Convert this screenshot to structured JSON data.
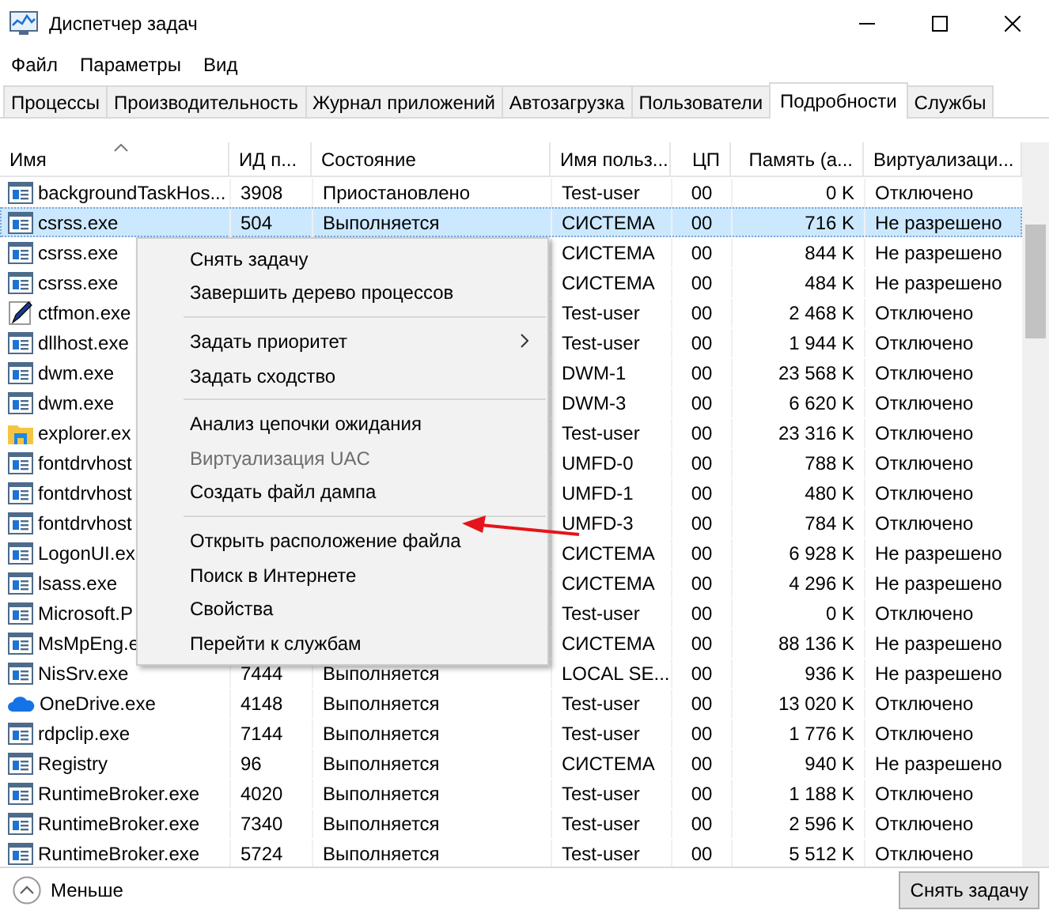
{
  "window": {
    "title": "Диспетчер задач"
  },
  "menu_bar": [
    "Файл",
    "Параметры",
    "Вид"
  ],
  "tabs": [
    {
      "label": "Процессы",
      "selected": false
    },
    {
      "label": "Производительность",
      "selected": false
    },
    {
      "label": "Журнал приложений",
      "selected": false
    },
    {
      "label": "Автозагрузка",
      "selected": false
    },
    {
      "label": "Пользователи",
      "selected": false
    },
    {
      "label": "Подробности",
      "selected": true
    },
    {
      "label": "Службы",
      "selected": false
    }
  ],
  "table": {
    "columns": [
      {
        "label": "Имя",
        "sorted": true
      },
      {
        "label": "ИД п...",
        "sorted": false
      },
      {
        "label": "Состояние",
        "sorted": false
      },
      {
        "label": "Имя польз...",
        "sorted": false
      },
      {
        "label": "ЦП",
        "sorted": false
      },
      {
        "label": "Память (а...",
        "sorted": false
      },
      {
        "label": "Виртуализаци...",
        "sorted": false
      }
    ],
    "rows": [
      {
        "kind": "app",
        "name": "backgroundTaskHos...",
        "pid": "3908",
        "state": "Приостановлено",
        "user": "Test-user",
        "cpu": "00",
        "memory": "0 K",
        "virtualization": "Отключено",
        "selected": false
      },
      {
        "kind": "app",
        "name": "csrss.exe",
        "pid": "504",
        "state": "Выполняется",
        "user": "СИСТЕМА",
        "cpu": "00",
        "memory": "716 K",
        "virtualization": "Не разрешено",
        "selected": true
      },
      {
        "kind": "app",
        "name": "csrss.exe",
        "user": "СИСТЕМА",
        "cpu": "00",
        "memory": "844 K",
        "virtualization": "Не разрешено",
        "selected": false
      },
      {
        "kind": "app",
        "name": "csrss.exe",
        "user": "СИСТЕМА",
        "cpu": "00",
        "memory": "484 K",
        "virtualization": "Не разрешено",
        "selected": false
      },
      {
        "kind": "pen",
        "name": "ctfmon.exe",
        "user": "Test-user",
        "cpu": "00",
        "memory": "2 468 K",
        "virtualization": "Отключено",
        "selected": false
      },
      {
        "kind": "app",
        "name": "dllhost.exe",
        "user": "Test-user",
        "cpu": "00",
        "memory": "1 944 K",
        "virtualization": "Отключено",
        "selected": false
      },
      {
        "kind": "app",
        "name": "dwm.exe",
        "user": "DWM-1",
        "cpu": "00",
        "memory": "23 568 K",
        "virtualization": "Отключено",
        "selected": false
      },
      {
        "kind": "app",
        "name": "dwm.exe",
        "user": "DWM-3",
        "cpu": "00",
        "memory": "6 620 K",
        "virtualization": "Отключено",
        "selected": false
      },
      {
        "kind": "folder",
        "name": "explorer.ex",
        "user": "Test-user",
        "cpu": "00",
        "memory": "23 316 K",
        "virtualization": "Отключено",
        "selected": false
      },
      {
        "kind": "app",
        "name": "fontdrvhost",
        "user": "UMFD-0",
        "cpu": "00",
        "memory": "788 K",
        "virtualization": "Отключено",
        "selected": false
      },
      {
        "kind": "app",
        "name": "fontdrvhost",
        "user": "UMFD-1",
        "cpu": "00",
        "memory": "480 K",
        "virtualization": "Отключено",
        "selected": false
      },
      {
        "kind": "app",
        "name": "fontdrvhost",
        "user": "UMFD-3",
        "cpu": "00",
        "memory": "784 K",
        "virtualization": "Отключено",
        "selected": false
      },
      {
        "kind": "app",
        "name": "LogonUI.ex",
        "user": "СИСТЕМА",
        "cpu": "00",
        "memory": "6 928 K",
        "virtualization": "Не разрешено",
        "selected": false
      },
      {
        "kind": "app",
        "name": "lsass.exe",
        "user": "СИСТЕМА",
        "cpu": "00",
        "memory": "4 296 K",
        "virtualization": "Не разрешено",
        "selected": false
      },
      {
        "kind": "app",
        "name": "Microsoft.P",
        "user": "Test-user",
        "cpu": "00",
        "memory": "0 K",
        "virtualization": "Отключено",
        "selected": false
      },
      {
        "kind": "app",
        "name": "MsMpEng.e",
        "user": "СИСТЕМА",
        "cpu": "00",
        "memory": "88 136 K",
        "virtualization": "Не разрешено",
        "selected": false
      },
      {
        "kind": "app",
        "name": "NisSrv.exe",
        "pid": "7444",
        "state": "Выполняется",
        "user": "LOCAL SE...",
        "cpu": "00",
        "memory": "936 K",
        "virtualization": "Не разрешено",
        "selected": false
      },
      {
        "kind": "cloud",
        "name": "OneDrive.exe",
        "pid": "4148",
        "state": "Выполняется",
        "user": "Test-user",
        "cpu": "00",
        "memory": "13 020 K",
        "virtualization": "Отключено",
        "selected": false
      },
      {
        "kind": "app",
        "name": "rdpclip.exe",
        "pid": "7144",
        "state": "Выполняется",
        "user": "Test-user",
        "cpu": "00",
        "memory": "1 776 K",
        "virtualization": "Отключено",
        "selected": false
      },
      {
        "kind": "app",
        "name": "Registry",
        "pid": "96",
        "state": "Выполняется",
        "user": "СИСТЕМА",
        "cpu": "00",
        "memory": "940 K",
        "virtualization": "Не разрешено",
        "selected": false
      },
      {
        "kind": "app",
        "name": "RuntimeBroker.exe",
        "pid": "4020",
        "state": "Выполняется",
        "user": "Test-user",
        "cpu": "00",
        "memory": "1 188 K",
        "virtualization": "Отключено",
        "selected": false
      },
      {
        "kind": "app",
        "name": "RuntimeBroker.exe",
        "pid": "7340",
        "state": "Выполняется",
        "user": "Test-user",
        "cpu": "00",
        "memory": "2 596 K",
        "virtualization": "Отключено",
        "selected": false
      },
      {
        "kind": "app",
        "name": "RuntimeBroker.exe",
        "pid": "5724",
        "state": "Выполняется",
        "user": "Test-user",
        "cpu": "00",
        "memory": "5 512 K",
        "virtualization": "Отключено",
        "selected": false
      }
    ]
  },
  "context_menu": {
    "groups": [
      [
        {
          "label": "Снять задачу",
          "disabled": false,
          "submenu": false
        },
        {
          "label": "Завершить дерево процессов",
          "disabled": false,
          "submenu": false
        }
      ],
      [
        {
          "label": "Задать приоритет",
          "disabled": false,
          "submenu": true
        },
        {
          "label": "Задать сходство",
          "disabled": false,
          "submenu": false
        }
      ],
      [
        {
          "label": "Анализ цепочки ожидания",
          "disabled": false,
          "submenu": false
        },
        {
          "label": "Виртуализация UAC",
          "disabled": true,
          "submenu": false
        },
        {
          "label": "Создать файл дампа",
          "disabled": false,
          "submenu": false
        }
      ],
      [
        {
          "label": "Открыть расположение файла",
          "disabled": false,
          "submenu": false
        },
        {
          "label": "Поиск в Интернете",
          "disabled": false,
          "submenu": false
        },
        {
          "label": "Свойства",
          "disabled": false,
          "submenu": false
        },
        {
          "label": "Перейти к службам",
          "disabled": false,
          "submenu": false
        }
      ]
    ]
  },
  "footer": {
    "toggle": "Меньше",
    "button": "Снять задачу"
  }
}
